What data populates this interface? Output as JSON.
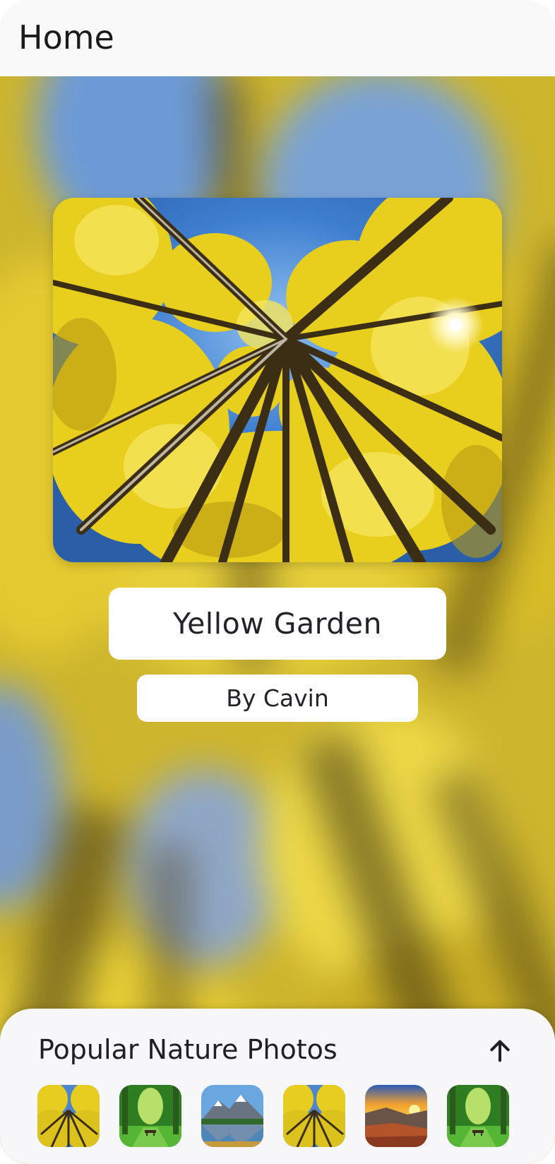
{
  "appbar": {
    "title": "Home"
  },
  "featured": {
    "title": "Yellow Garden",
    "author": "By Cavin",
    "image": "yellow-aspen-trees-photo"
  },
  "sheet": {
    "title": "Popular Nature Photos",
    "expand_icon": "arrow-up-icon",
    "thumbnails": [
      {
        "image": "yellow-aspen-trees-photo"
      },
      {
        "image": "green-forest-path-photo"
      },
      {
        "image": "mountain-lake-photo"
      },
      {
        "image": "yellow-aspen-trees-photo"
      },
      {
        "image": "sunset-canyon-photo"
      },
      {
        "image": "green-forest-path-photo"
      }
    ]
  },
  "colors": {
    "yellow_leaves": "#e8cf1e",
    "sky_blue": "#3f7fd0",
    "sheet_bg": "#f7f6f8"
  }
}
